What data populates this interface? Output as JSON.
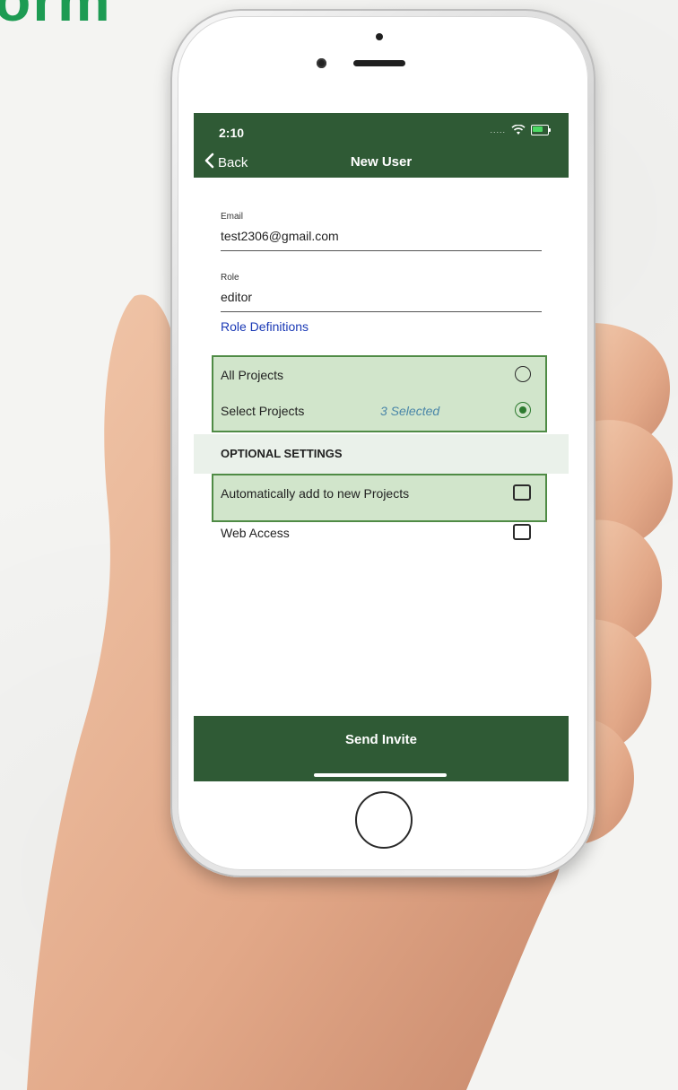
{
  "background": {
    "banner_text": "orm"
  },
  "status_bar": {
    "time": "2:10",
    "signal": "....."
  },
  "nav": {
    "back_label": "Back",
    "title": "New User"
  },
  "form": {
    "email_label": "Email",
    "email_value": "test2306@gmail.com",
    "role_label": "Role",
    "role_value": "editor",
    "role_definitions_link": "Role Definitions"
  },
  "projects": {
    "all_projects_label": "All Projects",
    "all_projects_selected": false,
    "select_projects_label": "Select Projects",
    "select_projects_selected": true,
    "selected_count": "3 Selected"
  },
  "optional_settings": {
    "header": "OPTIONAL SETTINGS",
    "auto_add_label": "Automatically add to new Projects",
    "auto_add_checked": false,
    "web_access_label": "Web Access",
    "web_access_checked": false
  },
  "footer": {
    "send_invite_label": "Send Invite"
  },
  "colors": {
    "primary_green": "#2f5a35",
    "highlight_green": "#4f8b45",
    "brand_text_green": "#1d9b53",
    "link_blue": "#1a39b5",
    "selected_count_blue": "#4a86a8"
  },
  "icons": {
    "back": "chevron-left-icon",
    "wifi": "wifi-icon",
    "battery": "battery-icon"
  }
}
